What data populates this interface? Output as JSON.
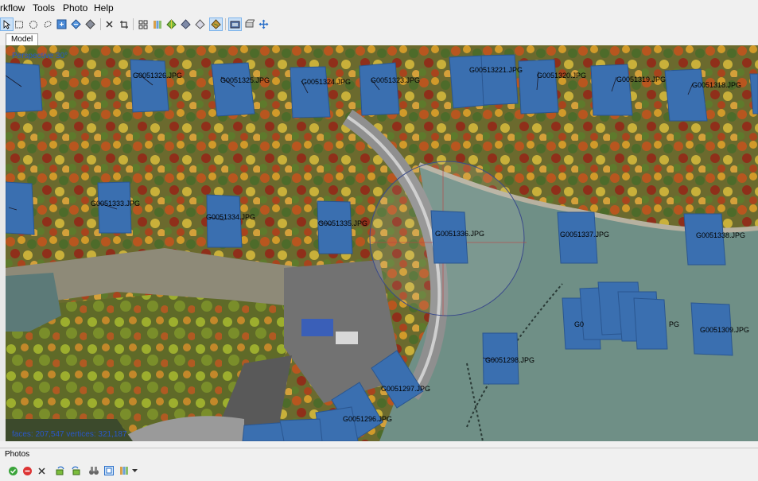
{
  "menu": {
    "items": [
      {
        "label": "rkflow",
        "key": "workflow"
      },
      {
        "label": "Tools",
        "key": "tools"
      },
      {
        "label": "Photo",
        "key": "photo"
      },
      {
        "label": "Help",
        "key": "help"
      }
    ]
  },
  "tabs": {
    "model_label": "Model"
  },
  "viewport": {
    "perspective_label": "Perspective 30°",
    "stats_label": "faces: 207,547 vertices: 321,187"
  },
  "cameras": {
    "labels": {
      "c1326": "G0051326.JPG",
      "c1325": "G0051325.JPG",
      "c1324": "G0051324.JPG",
      "c1323": "G0051323.JPG",
      "c1322": "G00513221.JPG",
      "c1320": "G0051320.JPG",
      "c1319": "G0051319.JPG",
      "c1318": "G0051318.JPG",
      "c1333": "G0051333.JPG",
      "c1334": "G0051334.JPG",
      "c1335": "G0051335.JPG",
      "c1336": "G0051336.JPG",
      "c1337": "G0051337.JPG",
      "c1338": "G0051338.JPG",
      "c1309": "G0051309.JPG",
      "c1298": "G0051298.JPG",
      "c1297": "G0051297.JPG",
      "c1296": "G0051296.JPG",
      "cluster_partial": "G0",
      "cluster_jpg": "PG"
    }
  },
  "photos_panel": {
    "title": "Photos"
  },
  "colors": {
    "camera_blue": "#3a6fb0",
    "overlay_text_blue": "#2a57c9",
    "water": "#6f8f86"
  }
}
